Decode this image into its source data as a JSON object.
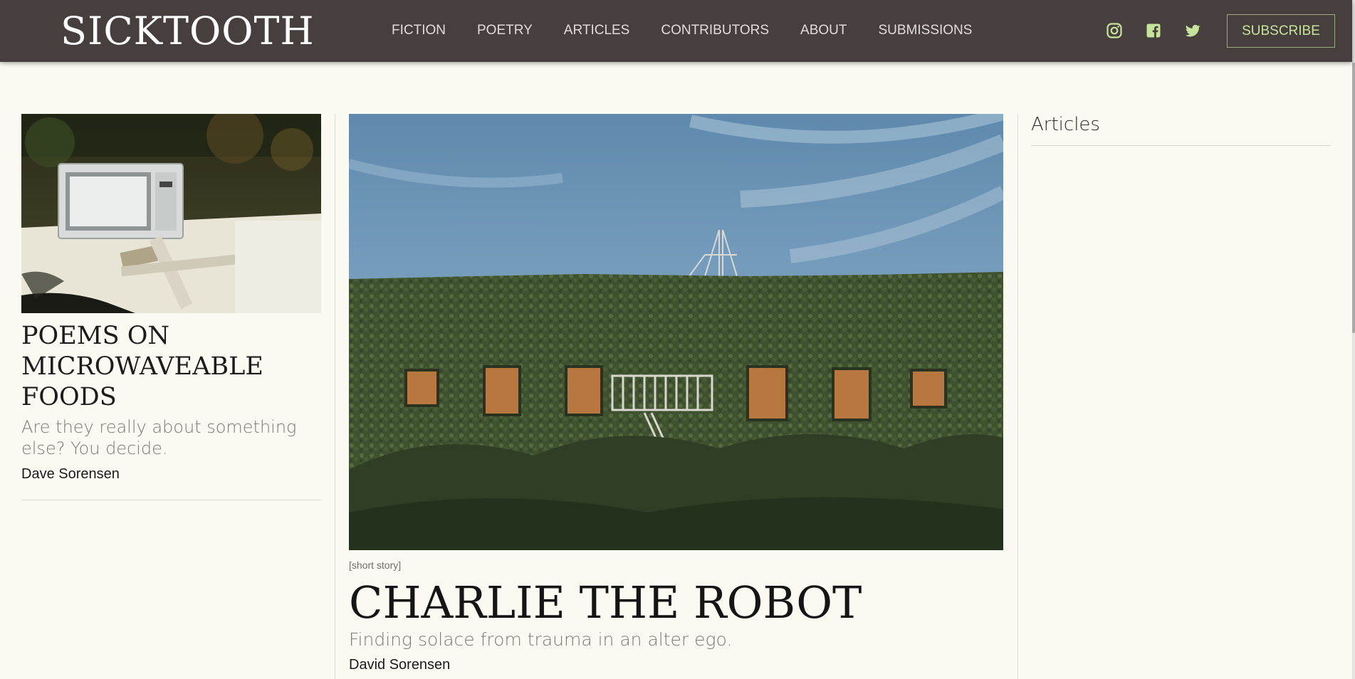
{
  "site": {
    "logo": "SICKTOOTH"
  },
  "nav": {
    "items": [
      {
        "label": "FICTION"
      },
      {
        "label": "POETRY"
      },
      {
        "label": "ARTICLES"
      },
      {
        "label": "CONTRIBUTORS"
      },
      {
        "label": "ABOUT"
      },
      {
        "label": "SUBMISSIONS"
      }
    ]
  },
  "social": {
    "icons": [
      "instagram-icon",
      "facebook-icon",
      "twitter-icon"
    ],
    "color": "#c6e39c"
  },
  "subscribe": {
    "label": "SUBSCRIBE"
  },
  "left_post": {
    "title": "POEMS ON MICROWAVEABLE FOODS",
    "subtitle": "Are they really about something else? You decide.",
    "author": "Dave Sorensen"
  },
  "featured": {
    "tag": "[short story]",
    "title": "CHARLIE THE ROBOT",
    "subtitle": "Finding solace from trauma in an alter ego.",
    "author": "David Sorensen"
  },
  "sidebar": {
    "heading": "Articles"
  },
  "colors": {
    "header_bg": "#463f3e",
    "page_bg": "#fafaf2",
    "accent": "#c6e39c"
  }
}
